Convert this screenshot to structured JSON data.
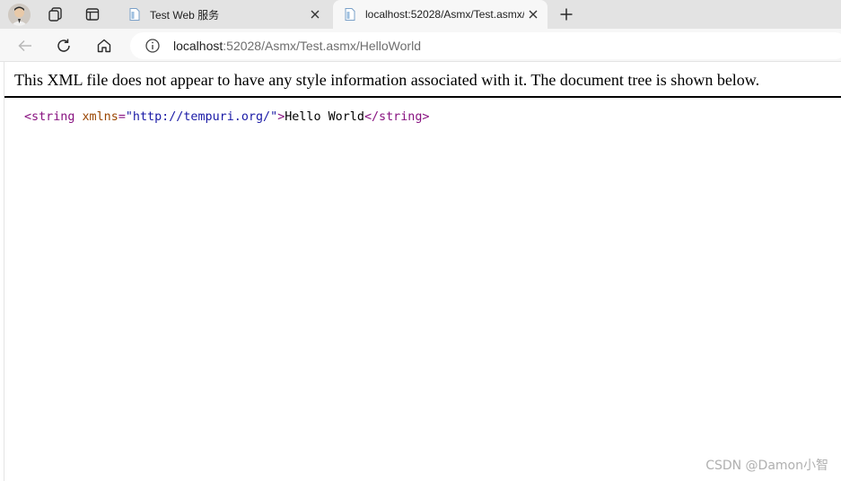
{
  "tabs": [
    {
      "title": "Test Web 服务",
      "icon": "page-icon",
      "active": false
    },
    {
      "title": "localhost:52028/Asmx/Test.asmx/",
      "icon": "page-icon",
      "active": true
    }
  ],
  "toolbar": {
    "url_host": "localhost",
    "url_rest": ":52028/Asmx/Test.asmx/HelloWorld"
  },
  "content": {
    "notice": "This XML file does not appear to have any style information associated with it. The document tree is shown below.",
    "xml": {
      "open_tag": "<string",
      "attr_name": "xmlns",
      "attr_eq": "=",
      "attr_value": "\"http://tempuri.org/\"",
      "open_tag_end": ">",
      "text": "Hello World",
      "close_tag": "</string>"
    }
  },
  "watermark": "CSDN @Damon小智",
  "colors": {
    "tag": "#881280",
    "attr_name": "#994500",
    "attr_value": "#1a1aa6"
  }
}
